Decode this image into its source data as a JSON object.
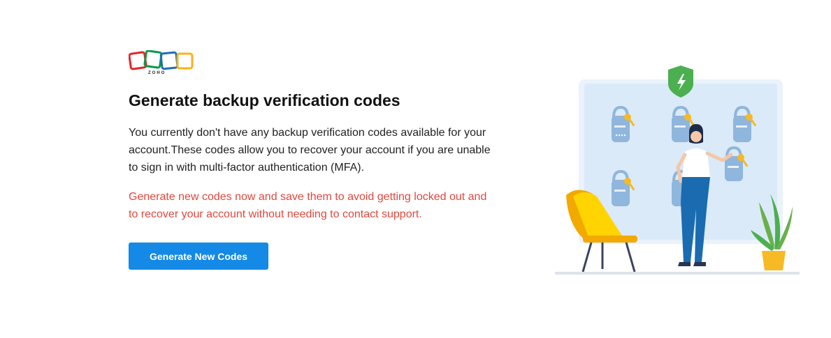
{
  "logo": {
    "text": "ZOHO",
    "icon": "zoho-logo-icon",
    "colors": [
      "#e42527",
      "#089949",
      "#226db4",
      "#f9b21d"
    ]
  },
  "title": "Generate backup verification codes",
  "description": "You currently don't have any backup verification codes available for your account.These codes allow you to recover your account if you are unable to sign in with multi-factor authentication (MFA).",
  "warning": "Generate new codes now and save them to avoid getting locked out and to recover your account without needing to contact support.",
  "button": {
    "label": "Generate New Codes"
  },
  "colors": {
    "accent": "#1489e6",
    "warning_text": "#e0483d",
    "title_text": "#111111"
  },
  "illustration": {
    "icon": "backup-codes-illustration",
    "shield_icon": "shield-lightning-icon"
  }
}
